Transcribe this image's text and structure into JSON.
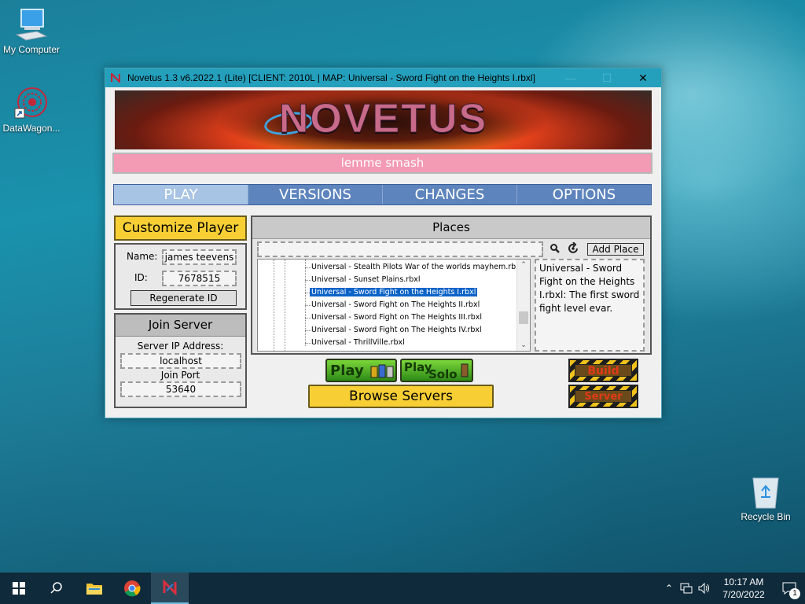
{
  "desktop": {
    "icons": [
      {
        "label": "My Computer"
      },
      {
        "label": "DataWagon..."
      },
      {
        "label": "Recycle Bin"
      }
    ]
  },
  "window": {
    "title": "Novetus 1.3 v6.2022.1 (Lite) [CLIENT: 2010L | MAP: Universal - Sword Fight on the Heights I.rbxl]",
    "minimize": "—",
    "maximize": "☐",
    "close": "✕"
  },
  "banner": {
    "logo_text": "NOVETUS"
  },
  "message": "lemme smash",
  "tabs": [
    {
      "label": "PLAY",
      "active": true
    },
    {
      "label": "VERSIONS",
      "active": false
    },
    {
      "label": "CHANGES",
      "active": false
    },
    {
      "label": "OPTIONS",
      "active": false
    }
  ],
  "player": {
    "customize_label": "Customize Player",
    "name_label": "Name:",
    "name_value": "james teevens",
    "id_label": "ID:",
    "id_value": "7678515",
    "regenerate_label": "Regenerate ID"
  },
  "join": {
    "header": "Join Server",
    "ip_label": "Server IP Address:",
    "ip_value": "localhost",
    "port_label": "Join Port",
    "port_value": "53640"
  },
  "places": {
    "header": "Places",
    "search_value": "",
    "add_place_label": "Add Place",
    "items": [
      {
        "label": "Universal - Stealth Pilots War of the worlds mayhem.rbxl",
        "selected": false
      },
      {
        "label": "Universal - Sunset Plains.rbxl",
        "selected": false
      },
      {
        "label": "Universal - Sword Fight on the Heights I.rbxl",
        "selected": true
      },
      {
        "label": "Universal - Sword Fight on The Heights II.rbxl",
        "selected": false
      },
      {
        "label": "Universal - Sword Fight on The Heights III.rbxl",
        "selected": false
      },
      {
        "label": "Universal - Sword Fight on The Heights IV.rbxl",
        "selected": false
      },
      {
        "label": "Universal - ThrillVille.rbxl",
        "selected": false
      }
    ],
    "description": "Universal - Sword Fight on the Heights I.rbxl: The first sword fight level evar."
  },
  "actions": {
    "play_label": "Play",
    "play_solo_label_1": "Play",
    "play_solo_label_2": "Solo",
    "browse_label": "Browse Servers",
    "build_label": "Build",
    "server_label": "Server"
  },
  "taskbar": {
    "time": "10:17 AM",
    "date": "7/20/2022",
    "notification_count": "1"
  }
}
